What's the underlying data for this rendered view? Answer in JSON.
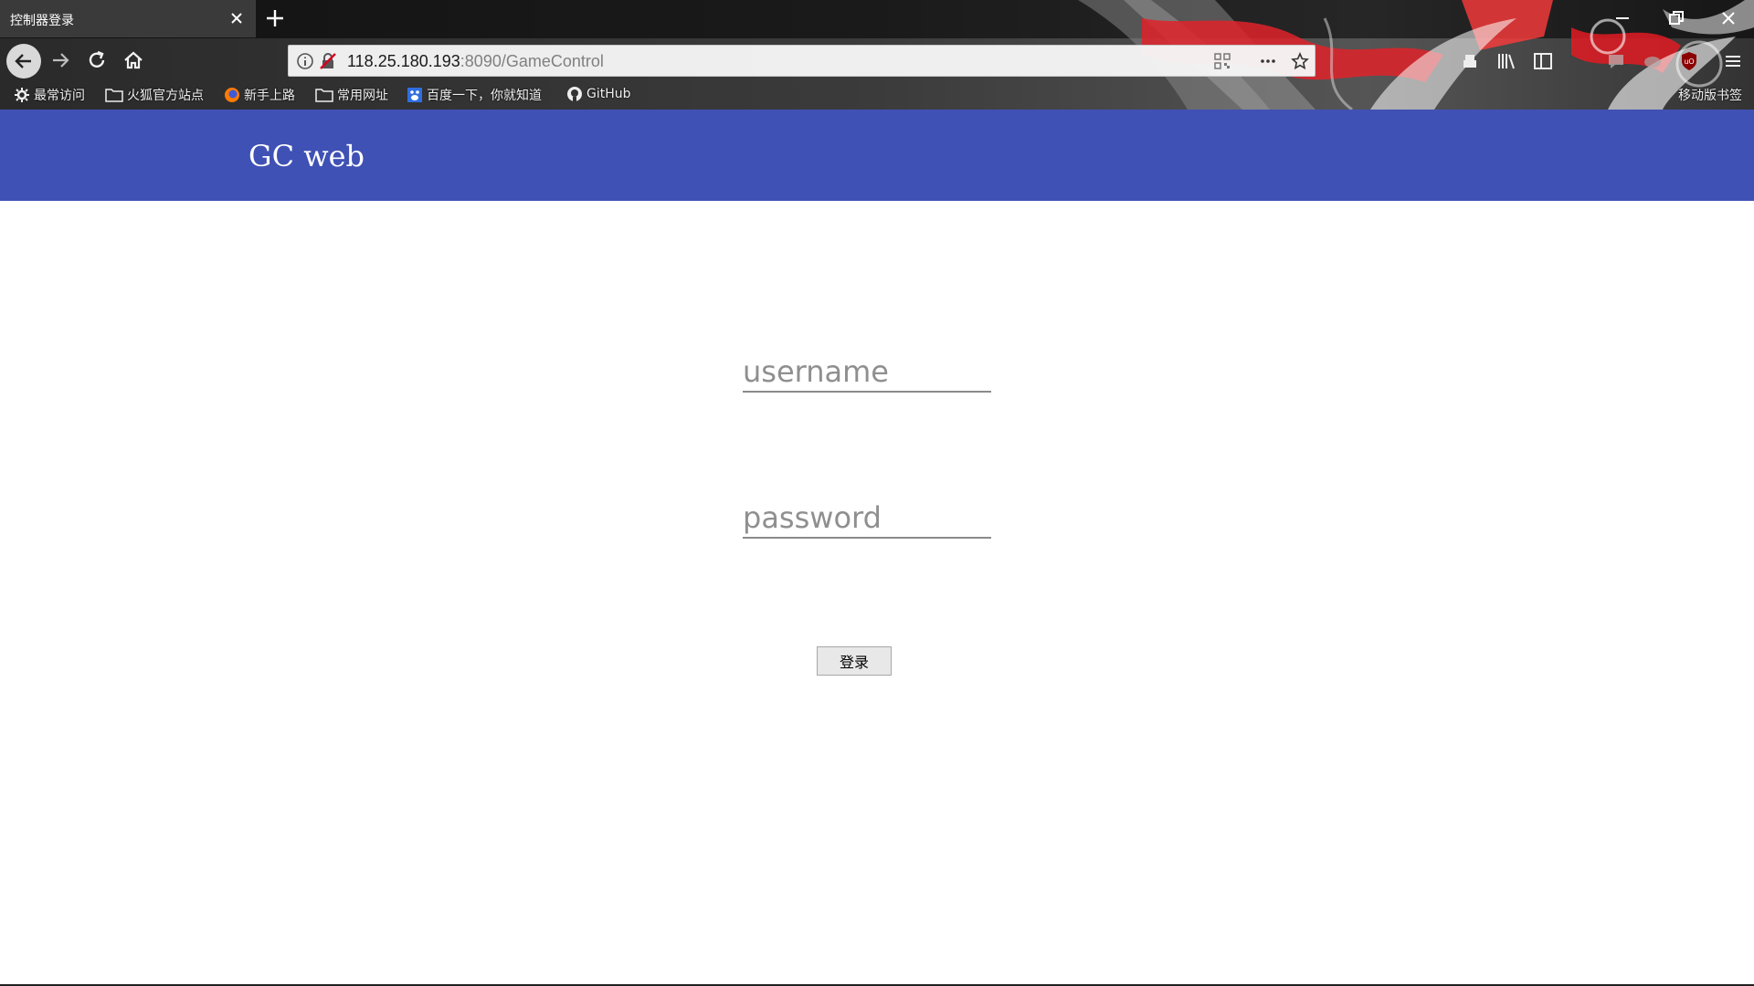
{
  "browser": {
    "tab_title": "控制器登录",
    "url_host": "118.25.180.193",
    "url_path": ":8090/GameControl",
    "bookmarks": [
      {
        "label": "最常访问",
        "icon": "gear-icon"
      },
      {
        "label": "火狐官方站点",
        "icon": "folder-icon"
      },
      {
        "label": "新手上路",
        "icon": "firefox-icon"
      },
      {
        "label": "常用网址",
        "icon": "folder-icon"
      },
      {
        "label": "百度一下，你就知道",
        "icon": "baidu-icon"
      },
      {
        "label": "GitHub",
        "icon": "github-icon"
      }
    ],
    "mobile_bookmarks": "移动版书签"
  },
  "app": {
    "title": "GC web",
    "header_color": "#3f51b5"
  },
  "login": {
    "username_placeholder": "username",
    "password_placeholder": "password",
    "submit_label": "登录"
  }
}
